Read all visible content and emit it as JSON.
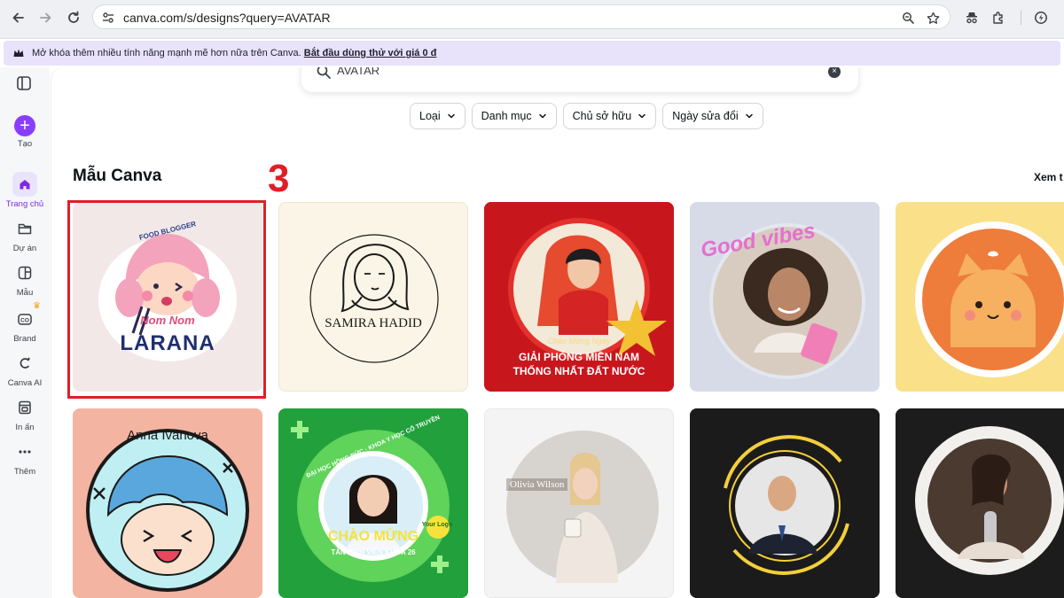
{
  "browser": {
    "url": "canva.com/s/designs?query=AVATAR",
    "back_icon": "back-arrow-icon",
    "forward_icon": "forward-arrow-icon",
    "reload_icon": "reload-icon"
  },
  "promo": {
    "text": "Mở khóa thêm nhiều tính năng mạnh mẽ hơn nữa trên Canva.",
    "link": "Bắt đầu dùng thử với giá 0 đ"
  },
  "rail": {
    "items": [
      {
        "label": "Tạo",
        "icon": "plus-icon"
      },
      {
        "label": "Trang chủ",
        "icon": "home-icon"
      },
      {
        "label": "Dự án",
        "icon": "folder-icon"
      },
      {
        "label": "Mẫu",
        "icon": "template-icon"
      },
      {
        "label": "Brand",
        "icon": "brand-icon"
      },
      {
        "label": "Canva AI",
        "icon": "canva-ai-icon"
      },
      {
        "label": "In ấn",
        "icon": "print-icon"
      },
      {
        "label": "Thêm",
        "icon": "more-icon"
      }
    ]
  },
  "search": {
    "value": "AVATAR"
  },
  "filters": [
    {
      "label": "Loại"
    },
    {
      "label": "Danh mục"
    },
    {
      "label": "Chủ sở hữu"
    },
    {
      "label": "Ngày sửa đổi"
    }
  ],
  "section": {
    "title": "Mẫu Canva",
    "see_all": "Xem t"
  },
  "annotation": {
    "step": "3",
    "color": "#e01e26"
  },
  "templates": {
    "row1": [
      {
        "name": "Nom Nom Larana food blogger avatar",
        "lines": [
          "FOOD BLOGGER",
          "Nom Nom",
          "LARANA"
        ]
      },
      {
        "name": "Samira Hadid avatar",
        "lines": [
          "SAMIRA HADID"
        ]
      },
      {
        "name": "Giải phóng miền Nam avatar",
        "lines": [
          "Chào Mừng Ngày",
          "GIẢI PHÓNG MIỀN NAM",
          "THỐNG NHẤT ĐẤT NƯỚC"
        ]
      },
      {
        "name": "Good vibes avatar",
        "lines": [
          "Good vibes"
        ]
      },
      {
        "name": "Orange cat avatar",
        "lines": []
      }
    ],
    "row2": [
      {
        "name": "Anna Ivanova avatar",
        "lines": [
          "Anna Ivanova"
        ]
      },
      {
        "name": "Chào mừng tân sinh viên avatar",
        "lines": [
          "ĐẠI HỌC HỒNG ĐỨC · KHOA Y HỌC CỔ TRUYỀN",
          "CHÀO MỪNG",
          "TÂN SINH VIÊN KHÓA 26",
          "Your Logo"
        ]
      },
      {
        "name": "Olivia Wilson avatar",
        "lines": [
          "Olivia Wilson"
        ]
      },
      {
        "name": "Business man avatar",
        "lines": []
      },
      {
        "name": "Singer torn paper avatar",
        "lines": []
      }
    ]
  },
  "colors": {
    "canva_purple": "#8b3dff",
    "promo_bg": "#e8e2fb"
  }
}
